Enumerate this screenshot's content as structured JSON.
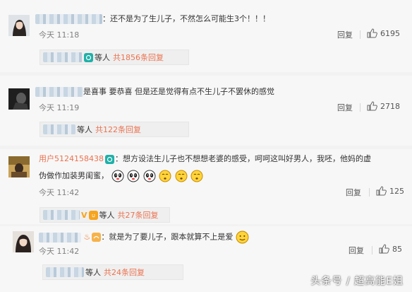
{
  "comments": [
    {
      "text": "还不是为了生儿子，不然怎么可能生3个！！！",
      "time": "今天 11:18",
      "reply_label": "回复",
      "likes": "6195",
      "sub_people": "等人",
      "sub_link": "共1856条回复"
    },
    {
      "text": "是喜事 要恭喜 但是还是觉得有点不生儿子不罢休的感觉",
      "time": "今天 11:19",
      "reply_label": "回复",
      "likes": "2718",
      "sub_people": "等人",
      "sub_link": "共122条回复"
    },
    {
      "username": "用户5124158438",
      "text_line1": "想方设法生儿子也不想想老婆的感受，呵呵这叫好男人，我呸，他妈的虚",
      "text_line2": "伪做作加装男闺蜜，",
      "time": "今天 11:42",
      "reply_label": "回复",
      "likes": "125",
      "sub_people": "等人",
      "sub_link": "共27条回复"
    },
    {
      "text": "就是为了要儿子，跟本就算不上是爱",
      "time": "今天 11:42",
      "reply_label": "回复",
      "likes": "85",
      "sub_people": "等人",
      "sub_link": "共24条回复"
    }
  ],
  "watermark": "头条号 / 超高能E姐",
  "icons": {
    "like": "thumbs-up-icon",
    "verified": "vip-badge-icon",
    "emoji": "emoji-face-icon"
  },
  "colors": {
    "link": "#eb7350",
    "time": "#808080",
    "background": "#f7f7f7"
  }
}
